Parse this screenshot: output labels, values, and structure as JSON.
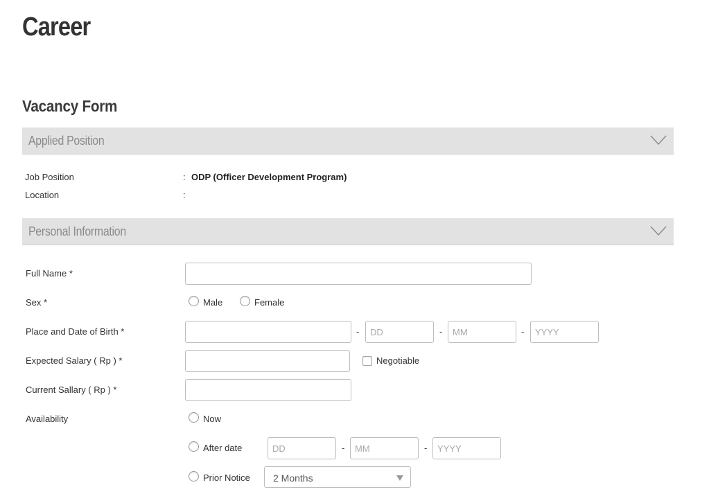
{
  "page": {
    "title": "Career"
  },
  "form": {
    "title": "Vacancy Form"
  },
  "sections": {
    "applied_position": {
      "label": "Applied Position"
    },
    "personal_information": {
      "label": "Personal Information"
    }
  },
  "applied_position": {
    "job_position": {
      "label": "Job Position",
      "colon": ":",
      "value": "ODP (Officer Development Program)"
    },
    "location": {
      "label": "Location",
      "colon": ":",
      "value": ""
    }
  },
  "personal": {
    "full_name": {
      "label": "Full Name *",
      "value": ""
    },
    "sex": {
      "label": "Sex *",
      "options": [
        "Male",
        "Female"
      ],
      "selected": null
    },
    "birth": {
      "label": "Place and Date of Birth *",
      "place_value": "",
      "separator": "-",
      "dd_placeholder": "DD",
      "mm_placeholder": "MM",
      "yyyy_placeholder": "YYYY"
    },
    "expected_salary": {
      "label": "Expected Salary ( Rp ) *",
      "value": "",
      "negotiable_label": "Negotiable",
      "negotiable_checked": false
    },
    "current_salary": {
      "label": "Current Sallary ( Rp ) *",
      "value": ""
    },
    "availability": {
      "label": "Availability",
      "now_label": "Now",
      "after_date_label": "After date",
      "separator": "-",
      "dd_placeholder": "DD",
      "mm_placeholder": "MM",
      "yyyy_placeholder": "YYYY",
      "prior_notice_label": "Prior Notice",
      "prior_notice_selected": "2 Months"
    }
  },
  "icons": {
    "section_toggle": "chevron-down-icon",
    "select_arrow": "caret-down-icon"
  }
}
